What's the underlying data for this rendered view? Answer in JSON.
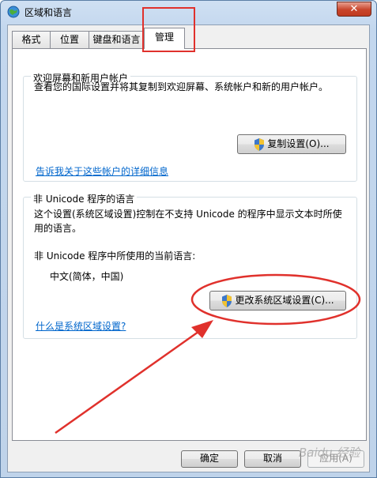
{
  "window": {
    "title": "区域和语言",
    "close_label": "✕"
  },
  "tabs": [
    {
      "label": "格式"
    },
    {
      "label": "位置"
    },
    {
      "label": "键盘和语言"
    },
    {
      "label": "管理",
      "active": true
    }
  ],
  "welcome_group": {
    "title": "欢迎屏幕和新用户帐户",
    "description": "查看您的国际设置并将其复制到欢迎屏幕、系统帐户和新的用户帐户。",
    "copy_button": "复制设置(O)...",
    "link": "告诉我关于这些帐户的详细信息"
  },
  "unicode_group": {
    "title": "非 Unicode 程序的语言",
    "description_line1": "这个设置(系统区域设置)控制在不支持 Unicode 的程序中显示文本时所使",
    "description_line2": "用的语言。",
    "current_label": "非 Unicode 程序中所使用的当前语言:",
    "current_value": "中文(简体，中国)",
    "change_button": "更改系统区域设置(C)...",
    "link": "什么是系统区域设置?"
  },
  "footer": {
    "ok": "确定",
    "cancel": "取消",
    "apply": "应用(A)"
  },
  "watermark": "Baidu 经验",
  "colors": {
    "annotation_red": "#e0312c",
    "link_blue": "#0066cc"
  }
}
